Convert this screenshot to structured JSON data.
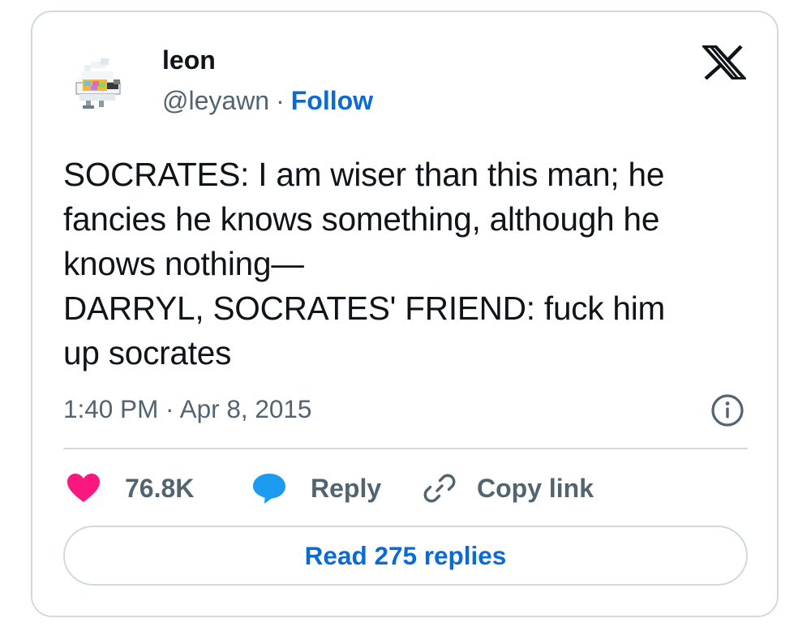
{
  "author": {
    "name": "leon",
    "handle": "@leyawn",
    "separator": "·",
    "follow_label": "Follow",
    "avatar_icon": "bird-with-sunglasses-avatar"
  },
  "brand": {
    "logo_icon": "x-logo-icon"
  },
  "tweet": {
    "lines": [
      "SOCRATES: I am wiser than this man; he",
      "fancies he knows something, although he",
      "knows nothing—",
      "DARRYL, SOCRATES' FRIEND: fuck him",
      "up socrates"
    ],
    "timestamp": "1:40 PM · Apr 8, 2015"
  },
  "actions": {
    "like_count": "76.8K",
    "reply_label": "Reply",
    "copy_link_label": "Copy link",
    "read_replies_label": "Read 275 replies"
  },
  "colors": {
    "like": "#f91880",
    "reply": "#1d9bf0",
    "follow": "#0a6ad6",
    "secondary_text": "#536471",
    "border": "#cfd9de"
  }
}
